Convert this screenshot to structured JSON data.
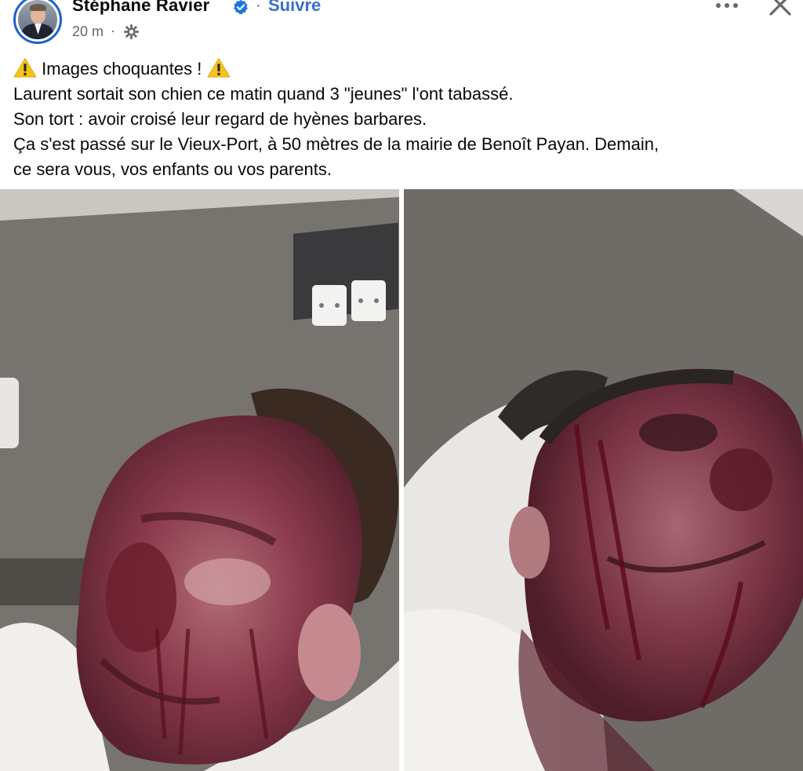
{
  "post": {
    "author_name": "Stéphane Ravier",
    "verified_icon": "verified-badge-icon",
    "separator": "·",
    "follow_label": "Suivre",
    "timestamp": "20 m",
    "privacy_icon": "public-globe-icon",
    "more_icon": "more-options-icon",
    "close_icon": "close-icon",
    "text": {
      "line1": "Images choquantes !",
      "line2": "Laurent sortait son chien ce matin quand 3 \"jeunes\" l'ont tabassé.",
      "line3": "Son tort : avoir croisé leur regard de hyènes barbares.",
      "line4": "Ça s'est passé sur le Vieux-Port, à 50 mètres de la mairie de Benoît Payan. Demain,",
      "line5": "ce sera vous, vos enfants ou vos parents.",
      "warning_icon": "warning-triangle-icon"
    },
    "photos": [
      {
        "subject": "photo-injured-face-left"
      },
      {
        "subject": "photo-injured-face-right"
      }
    ],
    "colors": {
      "follow": "#3b6fc9",
      "verified": "#1b74e4",
      "secondary_text": "#65676b",
      "warning": "#f7c21a"
    }
  }
}
